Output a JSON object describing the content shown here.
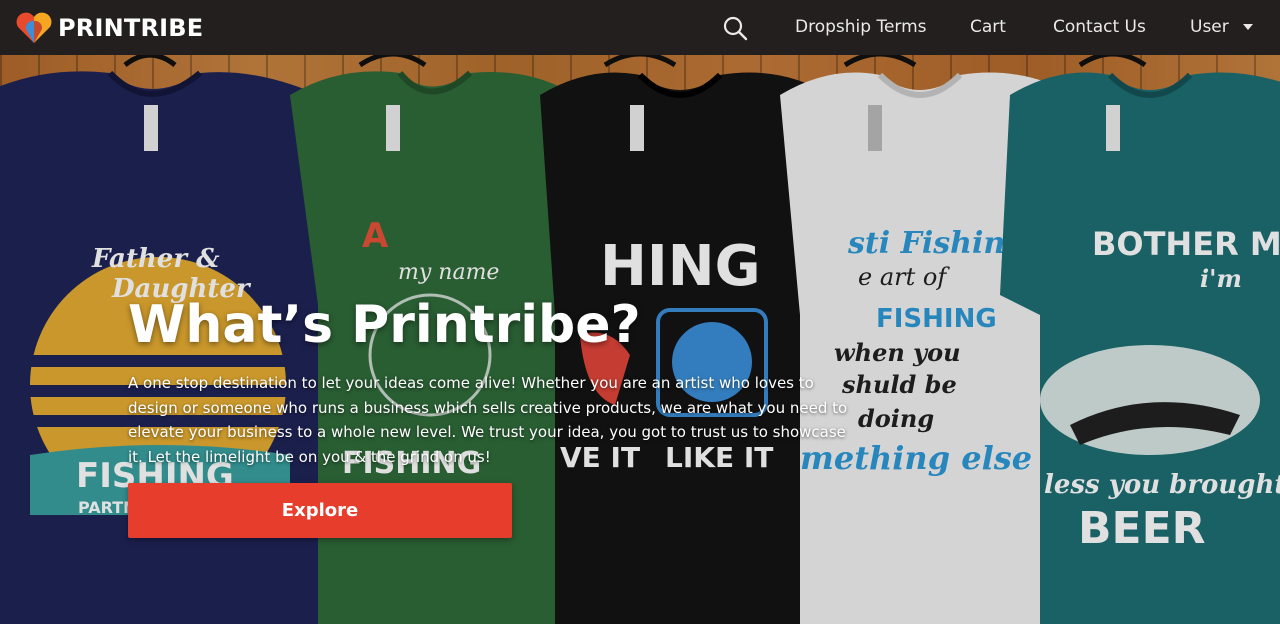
{
  "brand": {
    "name": "PRINTRIBE",
    "logo_icon": "heart-logo-icon"
  },
  "nav": {
    "search_icon": "search-icon",
    "dropship": "Dropship Terms",
    "cart": "Cart",
    "contact": "Contact Us",
    "user": "User"
  },
  "hero": {
    "title": "What’s Printribe?",
    "description": "A one stop destination to let your ideas come alive! Whether you are an artist who loves to design or someone who runs a business which sells creative products, we are what you need to elevate your business to a whole new level. We trust your idea, you got to trust us to showcase it. Let the limelight be on you & the grind on us!",
    "cta": "Explore"
  },
  "shirts": [
    {
      "color": "#1f2457",
      "lines": [
        "Father &",
        "Daughter",
        "FISHING",
        "PARTN"
      ]
    },
    {
      "color": "#2f6a3a",
      "lines": [
        "A",
        "my name",
        "FISHING"
      ]
    },
    {
      "color": "#141414",
      "lines": [
        "HING",
        "VE IT",
        "LIKE IT"
      ]
    },
    {
      "color": "#f2f2f2",
      "lines": [
        "sti Fishing",
        "e art of",
        "FISHING",
        "when you",
        "shuld be",
        "doing",
        "mething else"
      ]
    },
    {
      "color": "#1d6f73",
      "lines": [
        "BOTHER ME",
        "i'm",
        "less you brought",
        "BEER"
      ]
    }
  ],
  "colors": {
    "navbar": "#231f1f",
    "accent": "#e73d2c",
    "text": "#ffffff"
  }
}
